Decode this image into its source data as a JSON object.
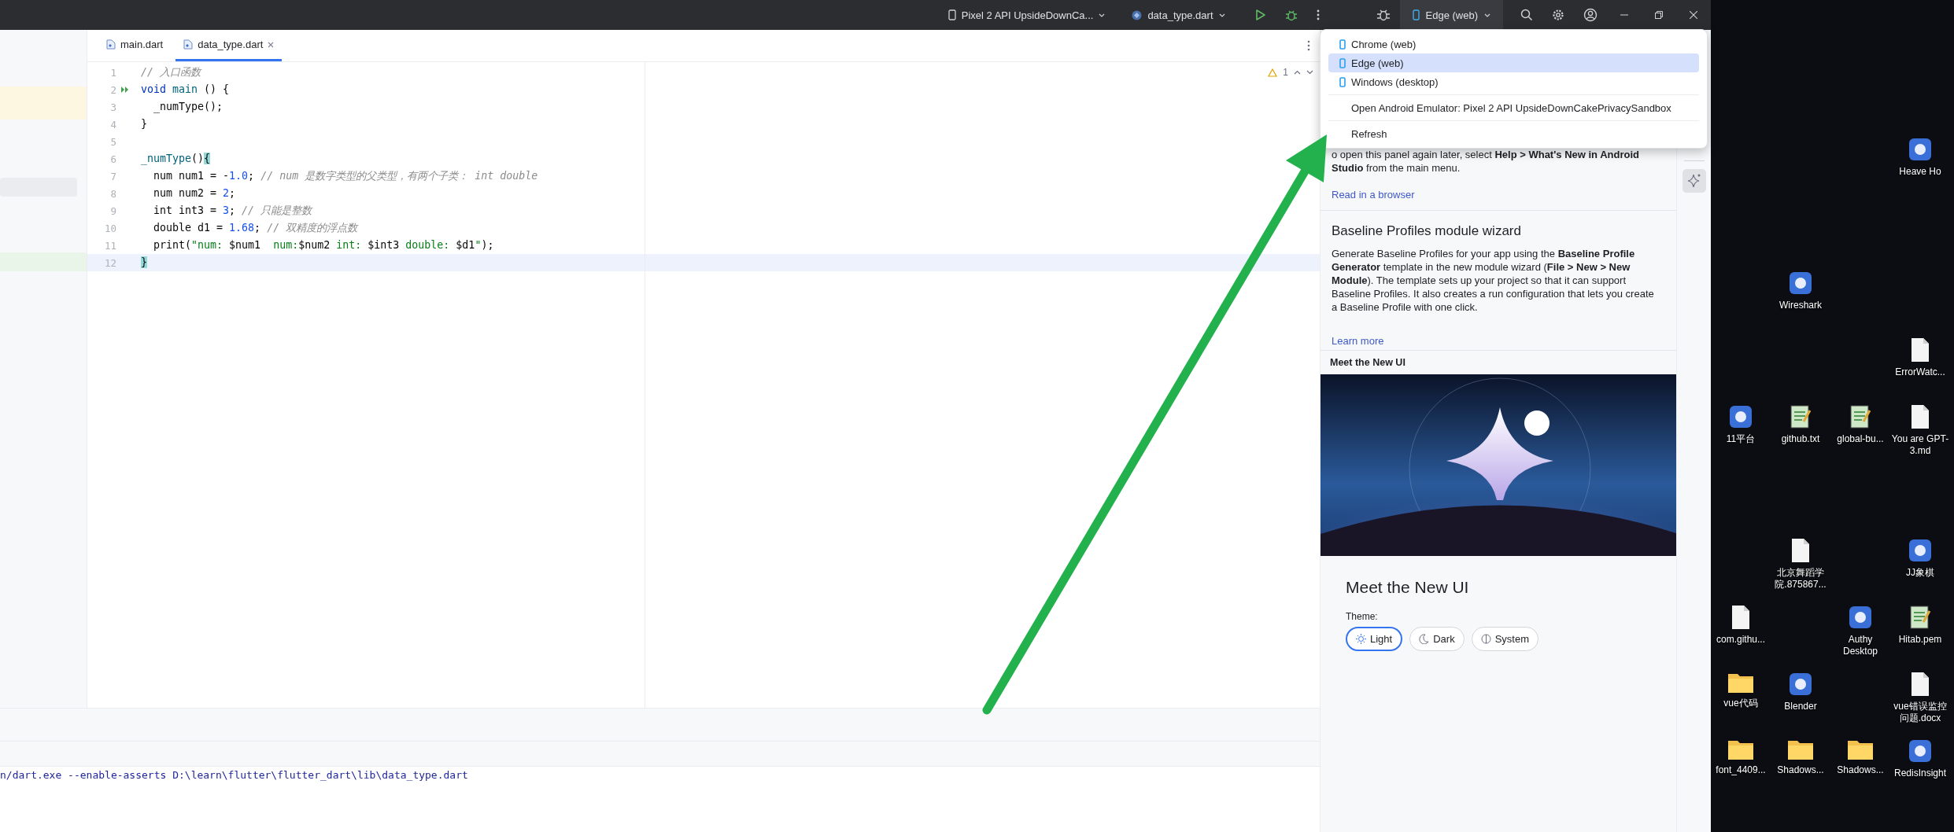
{
  "toolbar": {
    "device_config": "Pixel 2 API UpsideDownCa...",
    "run_config": "data_type.dart",
    "target_device": "Edge (web)"
  },
  "tabs": [
    {
      "label": "main.dart",
      "selected": false
    },
    {
      "label": "data_type.dart",
      "selected": true
    }
  ],
  "editor": {
    "warnings": "1",
    "lines": [
      {
        "number": "1",
        "runnable": false,
        "current": false,
        "tokens": [
          {
            "text": "// 入口函数",
            "kind": "comment"
          }
        ]
      },
      {
        "number": "2",
        "runnable": true,
        "current": false,
        "tokens": [
          {
            "text": "void ",
            "kind": "keyword"
          },
          {
            "text": "main",
            "kind": "function"
          },
          {
            "text": " () {",
            "kind": "plain"
          }
        ]
      },
      {
        "number": "3",
        "runnable": false,
        "current": false,
        "tokens": [
          {
            "text": "  _numType();",
            "kind": "plain"
          }
        ]
      },
      {
        "number": "4",
        "runnable": false,
        "current": false,
        "tokens": [
          {
            "text": "}",
            "kind": "plain"
          }
        ]
      },
      {
        "number": "5",
        "runnable": false,
        "current": false
      },
      {
        "number": "6",
        "runnable": false,
        "current": false,
        "tokens": [
          {
            "text": "_numType",
            "kind": "function"
          },
          {
            "text": "()",
            "kind": "plain"
          },
          {
            "text": "{",
            "kind": "match"
          }
        ]
      },
      {
        "number": "7",
        "runnable": false,
        "current": false,
        "tokens": [
          {
            "text": "  num num1 = -",
            "kind": "plain"
          },
          {
            "text": "1.0",
            "kind": "number"
          },
          {
            "text": "; ",
            "kind": "plain"
          },
          {
            "text": "// num 是数字类型的父类型，有两个子类： int double",
            "kind": "comment"
          }
        ]
      },
      {
        "number": "8",
        "runnable": false,
        "current": false,
        "tokens": [
          {
            "text": "  num num2 = ",
            "kind": "plain"
          },
          {
            "text": "2",
            "kind": "number"
          },
          {
            "text": ";",
            "kind": "plain"
          }
        ]
      },
      {
        "number": "9",
        "runnable": false,
        "current": false,
        "tokens": [
          {
            "text": "  int int3 = ",
            "kind": "plain"
          },
          {
            "text": "3",
            "kind": "number"
          },
          {
            "text": "; ",
            "kind": "plain"
          },
          {
            "text": "// 只能是整数",
            "kind": "comment"
          }
        ]
      },
      {
        "number": "10",
        "runnable": false,
        "current": false,
        "tokens": [
          {
            "text": "  double d1 = ",
            "kind": "plain"
          },
          {
            "text": "1.68",
            "kind": "number"
          },
          {
            "text": "; ",
            "kind": "plain"
          },
          {
            "text": "// 双精度的浮点数",
            "kind": "comment"
          }
        ]
      },
      {
        "number": "11",
        "runnable": false,
        "current": false,
        "tokens": [
          {
            "text": "  print(",
            "kind": "plain"
          },
          {
            "text": "\"num: ",
            "kind": "string"
          },
          {
            "text": "$num1",
            "kind": "plain"
          },
          {
            "text": "  num:",
            "kind": "string"
          },
          {
            "text": "$num2",
            "kind": "plain"
          },
          {
            "text": " int: ",
            "kind": "string"
          },
          {
            "text": "$int3",
            "kind": "plain"
          },
          {
            "text": " double: ",
            "kind": "string"
          },
          {
            "text": "$d1",
            "kind": "plain"
          },
          {
            "text": "\"",
            "kind": "string"
          },
          {
            "text": ");",
            "kind": "plain"
          }
        ]
      },
      {
        "number": "12",
        "runnable": false,
        "current": true,
        "tokens": [
          {
            "text": "}",
            "kind": "match"
          }
        ]
      }
    ]
  },
  "device_menu": {
    "groups": [
      {
        "items": [
          {
            "kind": "device",
            "label": "Chrome (web)",
            "selected": false
          },
          {
            "kind": "device",
            "label": "Edge (web)",
            "selected": true
          },
          {
            "kind": "device",
            "label": "Windows (desktop)",
            "selected": false
          }
        ]
      },
      {
        "items": [
          {
            "kind": "action",
            "label": "Open Android Emulator: Pixel 2 API UpsideDownCakePrivacySandbox",
            "selected": false
          }
        ]
      },
      {
        "items": [
          {
            "kind": "action",
            "label": "Refresh",
            "selected": false
          }
        ]
      }
    ]
  },
  "whats_new": {
    "intro": "o open this panel again later, select **Help > What's New in Android Studio** from the main menu.",
    "read_link": "Read in a browser",
    "section": {
      "title": "Baseline Profiles module wizard",
      "body": "Generate Baseline Profiles for your app using the **Baseline Profile Generator** template in the new module wizard (**File > New > New Module**). The template sets up your project so that it can support Baseline Profiles. It also creates a run configuration that lets you create a Baseline Profile with one click.",
      "link": "Learn more"
    },
    "feature": {
      "header": "Meet the New UI",
      "title": "Meet the New UI",
      "theme_label": "Theme:",
      "themes": [
        {
          "kind": "light",
          "label": "Light",
          "selected": true
        },
        {
          "kind": "dark",
          "label": "Dark",
          "selected": false
        },
        {
          "kind": "system",
          "label": "System",
          "selected": false
        }
      ]
    }
  },
  "console": {
    "line": "n/dart.exe --enable-asserts D:\\learn\\flutter\\flutter_dart\\lib\\data_type.dart"
  },
  "desktop": {
    "icons": [
      {
        "label": "Heave Ho",
        "kind": "app"
      },
      {
        "label": "Wireshark",
        "kind": "app"
      },
      {
        "label": "ErrorWatc...",
        "kind": "file"
      },
      {
        "label": "11平台",
        "kind": "app"
      },
      {
        "label": "github.txt",
        "kind": "text"
      },
      {
        "label": "global-bu...",
        "kind": "text"
      },
      {
        "label": "You are GPT-3.md",
        "kind": "file"
      },
      {
        "label": "北京舞蹈学院.875867...",
        "kind": "file"
      },
      {
        "label": "JJ象棋",
        "kind": "app"
      },
      {
        "label": "com.githu...",
        "kind": "file"
      },
      {
        "label": "Authy Desktop",
        "kind": "app"
      },
      {
        "label": "Hitab.pem",
        "kind": "text"
      },
      {
        "label": "vue代码",
        "kind": "folder"
      },
      {
        "label": "Blender",
        "kind": "app"
      },
      {
        "label": "vue错误监控问题.docx",
        "kind": "file"
      },
      {
        "label": "font_4409...",
        "kind": "folder"
      },
      {
        "label": "Shadows...",
        "kind": "folder"
      },
      {
        "label": "Shadows...",
        "kind": "folder"
      },
      {
        "label": "RedisInsight",
        "kind": "app"
      }
    ]
  }
}
